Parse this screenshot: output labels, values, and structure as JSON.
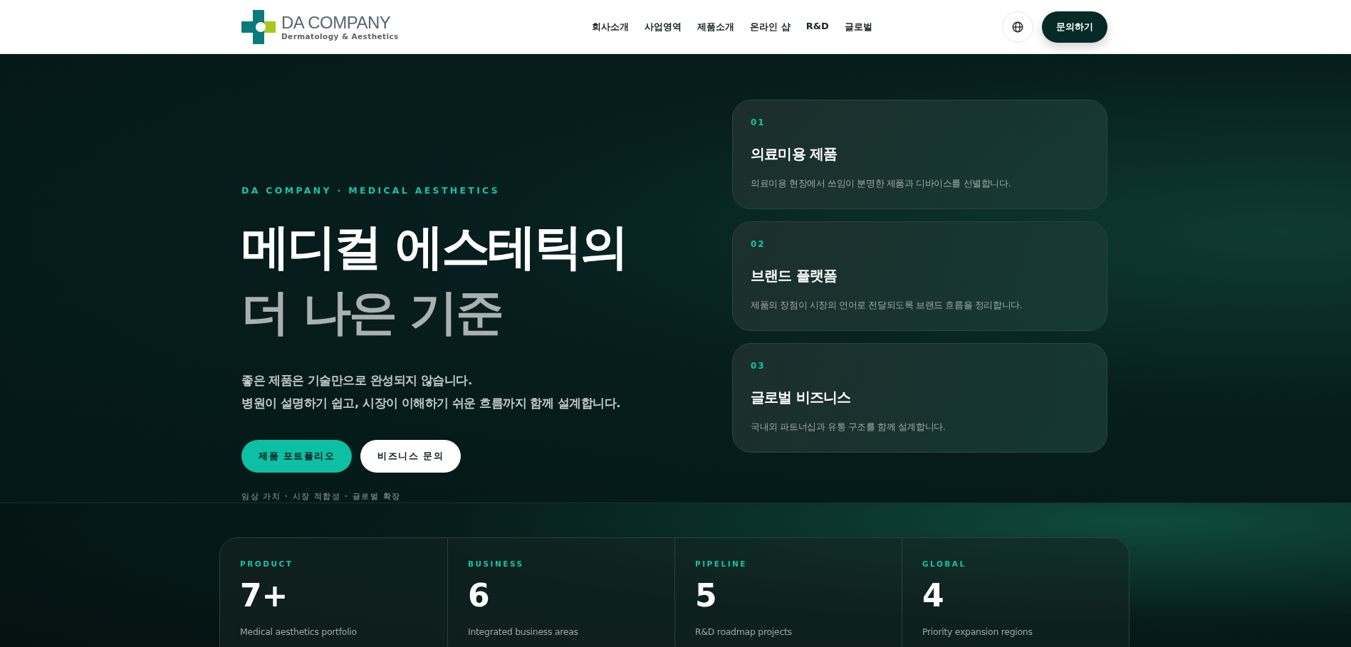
{
  "header": {
    "logo": {
      "name": "DA COMPANY",
      "tagline": "Dermatology & Aesthetics"
    },
    "nav": [
      "회사소개",
      "사업영역",
      "제품소개",
      "온라인 샵",
      "R&D",
      "글로벌"
    ],
    "contact_button": "문의하기"
  },
  "hero": {
    "eyebrow": "DA COMPANY · MEDICAL AESTHETICS",
    "title_line_1": "메디컬 에스테틱의",
    "title_line_2": "더 나은 기준",
    "paragraphs": [
      "좋은 제품은 기술만으로 완성되지 않습니다.",
      "병원이 설명하기 쉽고, 시장이 이해하기 쉬운 흐름까지 함께 설계합니다."
    ],
    "buttons": [
      {
        "label": "제품 포트폴리오",
        "kind": "primary"
      },
      {
        "label": "비즈니스 문의",
        "kind": "secondary"
      }
    ],
    "tags": "임상 가치 · 시장 적합성 · 글로벌 확장",
    "cards": [
      {
        "number": "01",
        "title": "의료미용 제품",
        "text": "의료미용 현장에서 쓰임이 분명한 제품과 디바이스를 선별합니다."
      },
      {
        "number": "02",
        "title": "브랜드 플랫폼",
        "text": "제품의 장점이 시장의 언어로 전달되도록 브랜드 흐름을 정리합니다."
      },
      {
        "number": "03",
        "title": "글로벌 비즈니스",
        "text": "국내외 파트너십과 유통 구조를 함께 설계합니다."
      }
    ]
  },
  "stats": [
    {
      "label": "PRODUCT",
      "value": "7+",
      "text": "Medical aesthetics portfolio"
    },
    {
      "label": "BUSINESS",
      "value": "6",
      "text": "Integrated business areas"
    },
    {
      "label": "PIPELINE",
      "value": "5",
      "text": "R&D roadmap projects"
    },
    {
      "label": "GLOBAL",
      "value": "4",
      "text": "Priority expansion regions"
    }
  ]
}
